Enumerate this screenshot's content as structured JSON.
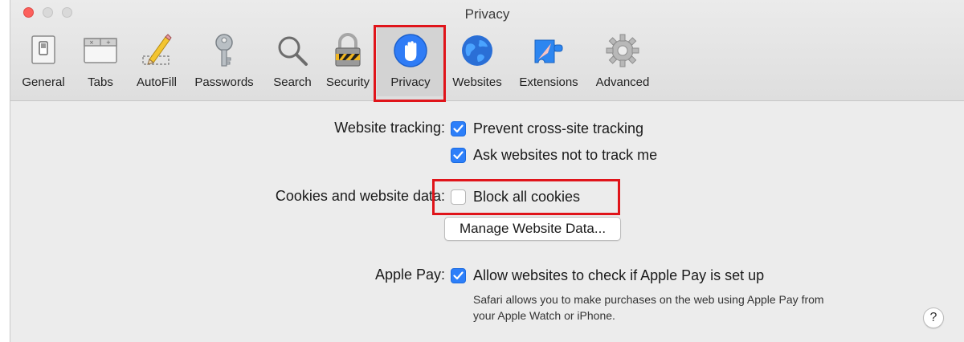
{
  "window": {
    "title": "Privacy"
  },
  "toolbar": {
    "tabs": [
      {
        "label": "General",
        "icon": "general-switch-icon"
      },
      {
        "label": "Tabs",
        "icon": "tabs-icon"
      },
      {
        "label": "AutoFill",
        "icon": "pencil-icon"
      },
      {
        "label": "Passwords",
        "icon": "key-icon"
      },
      {
        "label": "Search",
        "icon": "magnifier-icon"
      },
      {
        "label": "Security",
        "icon": "padlock-icon"
      },
      {
        "label": "Privacy",
        "icon": "hand-icon",
        "selected": true
      },
      {
        "label": "Websites",
        "icon": "globe-icon"
      },
      {
        "label": "Extensions",
        "icon": "puzzle-compass-icon"
      },
      {
        "label": "Advanced",
        "icon": "gear-icon"
      }
    ]
  },
  "privacy": {
    "tracking": {
      "label": "Website tracking:",
      "options": [
        {
          "text": "Prevent cross-site tracking",
          "checked": true
        },
        {
          "text": "Ask websites not to track me",
          "checked": true
        }
      ]
    },
    "cookies": {
      "label": "Cookies and website data:",
      "block_text": "Block all cookies",
      "block_checked": false,
      "manage_button": "Manage Website Data..."
    },
    "applepay": {
      "label": "Apple Pay:",
      "option_text": "Allow websites to check if Apple Pay is set up",
      "checked": true,
      "hint": "Safari allows you to make purchases on the web using Apple Pay from your Apple Watch or iPhone."
    },
    "help": "?"
  },
  "colors": {
    "accent": "#2d7ff9",
    "highlight": "#e0141a"
  }
}
